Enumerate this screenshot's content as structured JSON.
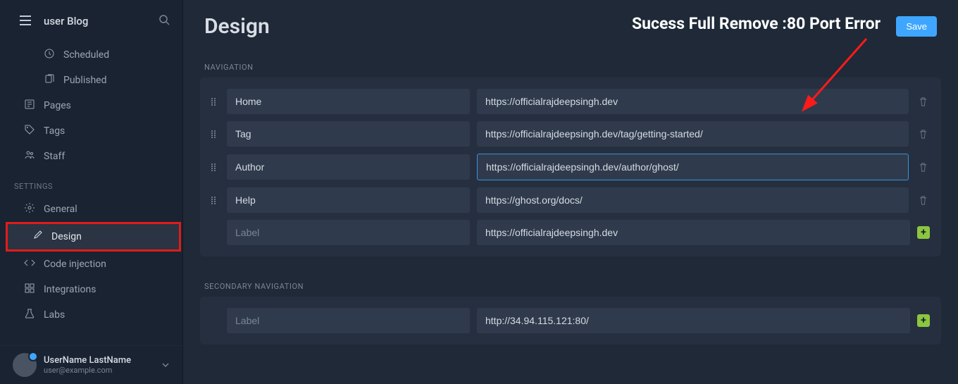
{
  "header": {
    "site_title": "user Blog"
  },
  "sidebar": {
    "content_items": [
      {
        "label": "Scheduled",
        "icon": "clock",
        "sub": true
      },
      {
        "label": "Published",
        "icon": "stack",
        "sub": true
      },
      {
        "label": "Pages",
        "icon": "pages",
        "sub": false
      },
      {
        "label": "Tags",
        "icon": "tag",
        "sub": false
      },
      {
        "label": "Staff",
        "icon": "staff",
        "sub": false
      }
    ],
    "settings_heading": "SETTINGS",
    "settings_items": [
      {
        "label": "General",
        "icon": "gear",
        "active": false,
        "highlight": false
      },
      {
        "label": "Design",
        "icon": "brush",
        "active": true,
        "highlight": true
      },
      {
        "label": "Code injection",
        "icon": "code",
        "active": false,
        "highlight": false
      },
      {
        "label": "Integrations",
        "icon": "integ",
        "active": false,
        "highlight": false
      },
      {
        "label": "Labs",
        "icon": "labs",
        "active": false,
        "highlight": false
      }
    ]
  },
  "user": {
    "name": "UserName LastName",
    "email": "user@example.com"
  },
  "page": {
    "title": "Design",
    "save_label": "Save"
  },
  "annotation": {
    "text": "Sucess Full Remove :80 Port Error"
  },
  "navigation": {
    "heading": "NAVIGATION",
    "rows": [
      {
        "label": "Home",
        "url": "https://officialrajdeepsingh.dev",
        "focused": false
      },
      {
        "label": "Tag",
        "url": "https://officialrajdeepsingh.dev/tag/getting-started/",
        "focused": false
      },
      {
        "label": "Author",
        "url": "https://officialrajdeepsingh.dev/author/ghost/",
        "focused": true
      },
      {
        "label": "Help",
        "url": "https://ghost.org/docs/",
        "focused": false
      }
    ],
    "new_row": {
      "label_placeholder": "Label",
      "url_value": "https://officialrajdeepsingh.dev"
    }
  },
  "secondary_navigation": {
    "heading": "SECONDARY NAVIGATION",
    "new_row": {
      "label_placeholder": "Label",
      "url_value": "http://34.94.115.121:80/"
    }
  }
}
